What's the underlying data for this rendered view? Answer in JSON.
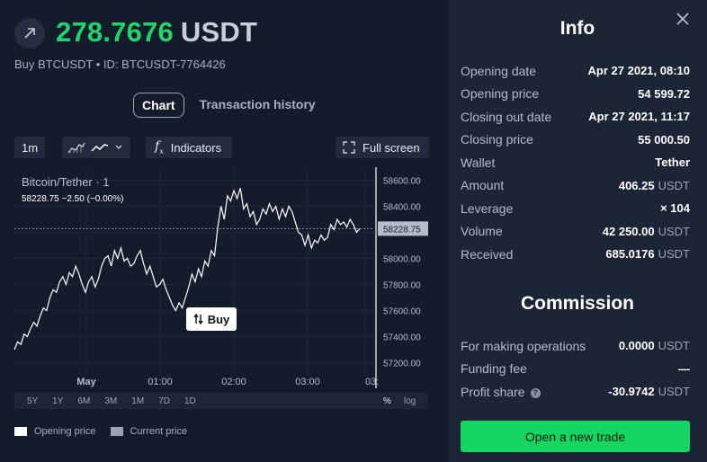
{
  "header": {
    "profit_value": "278.7676",
    "profit_currency": "USDT",
    "subtitle": "Buy BTCUSDT • ID: BTCUSDT-7764426"
  },
  "tabs": [
    {
      "label": "Chart",
      "active": true
    },
    {
      "label": "Transaction history",
      "active": false
    }
  ],
  "toolbar": {
    "timeframe": "1m",
    "indicators_label": "Indicators",
    "fullscreen_label": "Full screen"
  },
  "chart_data": {
    "type": "line",
    "legend_label": "Bitcoin/Tether · 1",
    "stats": "58228.75  −2.50 (−0.00%)",
    "x_tick_labels": [
      "May",
      "01:00",
      "02:00",
      "03:00",
      "03:"
    ],
    "y_tick_labels": [
      "58600.00",
      "58400.00",
      "58200.00",
      "58000.00",
      "57800.00",
      "57600.00",
      "57400.00",
      "57200.00"
    ],
    "ylim": [
      57100,
      58700
    ],
    "current_price_label": "58228.75",
    "current_price": 58228.75,
    "series": [
      {
        "values": [
          57300,
          57360,
          57340,
          57420,
          57400,
          57460,
          57510,
          57480,
          57560,
          57620,
          57600,
          57700,
          57760,
          57740,
          57820,
          57860,
          57800,
          57890,
          57860,
          57940,
          57880,
          57800,
          57740,
          57820,
          57860,
          57780,
          57840,
          57940,
          58000,
          58020,
          57940,
          58060,
          58000,
          58080,
          57980,
          58000,
          57940,
          57960,
          58020,
          58060,
          57960,
          57880,
          57940,
          57860,
          57780,
          57800,
          57840,
          57760,
          57700,
          57640,
          57600,
          57660,
          57620,
          57700,
          57780,
          57880,
          57820,
          57920,
          57860,
          57980,
          57940,
          58060,
          58020,
          58240,
          58400,
          58300,
          58480,
          58440,
          58520,
          58460,
          58540,
          58380,
          58420,
          58320,
          58360,
          58260,
          58300,
          58380,
          58340,
          58420,
          58360,
          58400,
          58300,
          58380,
          58320,
          58400,
          58360,
          58280,
          58200,
          58180,
          58100,
          58180,
          58080,
          58140,
          58120,
          58180,
          58140,
          58160,
          58260,
          58220,
          58300,
          58260,
          58280,
          58240,
          58300,
          58260,
          58200,
          58228
        ]
      }
    ],
    "buy_marker": {
      "label": "Buy",
      "price": 57600
    }
  },
  "range_buttons": [
    "5Y",
    "1Y",
    "6M",
    "3M",
    "1M",
    "7D",
    "1D"
  ],
  "scale_buttons": [
    "%",
    "log"
  ],
  "legend": [
    {
      "label": "Opening price",
      "color": "#ffffff"
    },
    {
      "label": "Current price",
      "color": "#9aa3b2"
    }
  ],
  "info": {
    "title": "Info",
    "rows": [
      {
        "key": "Opening date",
        "value": "Apr 27 2021, 08:10",
        "unit": ""
      },
      {
        "key": "Opening price",
        "value": "54 599.72",
        "unit": ""
      },
      {
        "key": "Closing out date",
        "value": "Apr 27 2021, 11:17",
        "unit": ""
      },
      {
        "key": "Closing price",
        "value": "55 000.50",
        "unit": ""
      },
      {
        "key": "Wallet",
        "value": "Tether",
        "unit": ""
      },
      {
        "key": "Amount",
        "value": "406.25",
        "unit": "USDT"
      },
      {
        "key": "Leverage",
        "value": "× 104",
        "unit": ""
      },
      {
        "key": "Volume",
        "value": "42 250.00",
        "unit": "USDT"
      },
      {
        "key": "Received",
        "value": "685.0176",
        "unit": "USDT"
      }
    ]
  },
  "commission": {
    "title": "Commission",
    "rows": [
      {
        "key": "For making operations",
        "value": "0.0000",
        "unit": "USDT",
        "help": false
      },
      {
        "key": "Funding fee",
        "value": "—",
        "unit": "",
        "help": false
      },
      {
        "key": "Profit share",
        "value": "-30.9742",
        "unit": "USDT",
        "help": true
      }
    ]
  },
  "cta_label": "Open a new trade",
  "colors": {
    "accent": "#14d660",
    "profit": "#1fd46a",
    "background": "#141b2b",
    "panel": "#1c2536"
  }
}
